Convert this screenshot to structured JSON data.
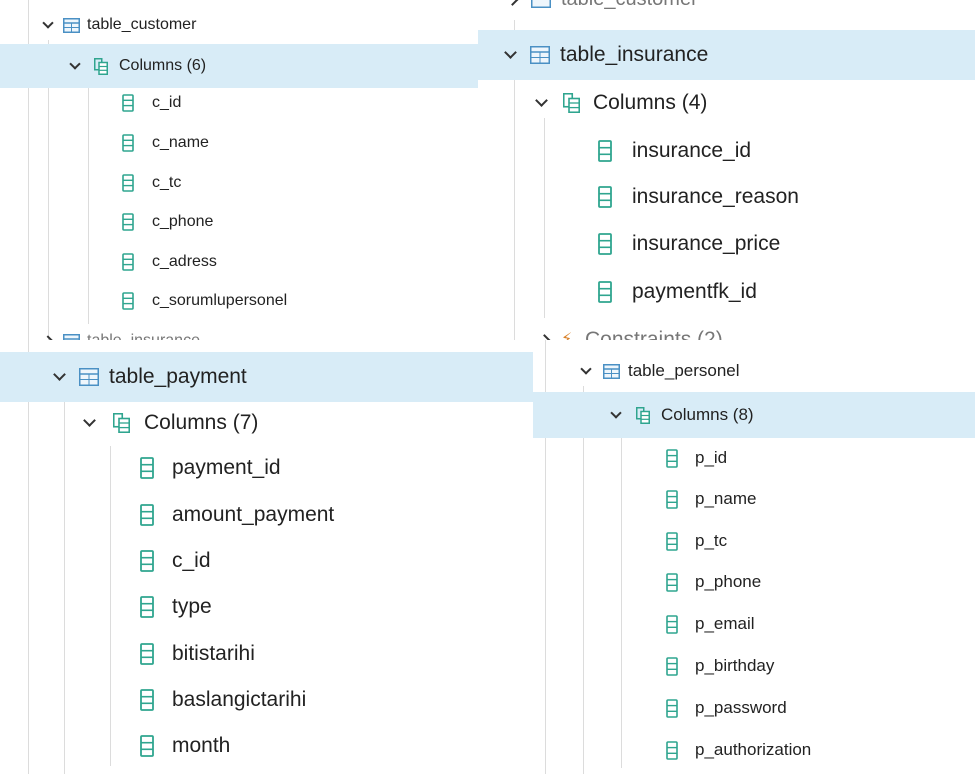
{
  "colors": {
    "highlight": "#d8ecf7",
    "table_icon": "#4a90c4",
    "column_icon": "#2fa58f",
    "constraint_icon": "#d9822b"
  },
  "customer_panel": {
    "table": {
      "label": "table_customer",
      "icon": "table-icon"
    },
    "group": {
      "label": "Columns (6)",
      "icon": "columns-icon"
    },
    "columns": [
      "c_id",
      "c_name",
      "c_tc",
      "c_phone",
      "c_adress",
      "c_sorumlupersonel"
    ],
    "next_item_partial": "table_insurance"
  },
  "insurance_panel": {
    "prev_item_partial": "table_customer",
    "table": {
      "label": "table_insurance",
      "icon": "table-icon"
    },
    "group": {
      "label": "Columns (4)",
      "icon": "columns-icon"
    },
    "columns": [
      "insurance_id",
      "insurance_reason",
      "insurance_price",
      "paymentfk_id"
    ],
    "next_item_partial": "Constraints (2)"
  },
  "payment_panel": {
    "table": {
      "label": "table_payment",
      "icon": "table-icon"
    },
    "group": {
      "label": "Columns (7)",
      "icon": "columns-icon"
    },
    "columns": [
      "payment_id",
      "amount_payment",
      "c_id",
      "type",
      "bitistarihi",
      "baslangictarihi",
      "month"
    ]
  },
  "personel_panel": {
    "table": {
      "label": "table_personel",
      "icon": "table-icon"
    },
    "group": {
      "label": "Columns (8)",
      "icon": "columns-icon"
    },
    "columns": [
      "p_id",
      "p_name",
      "p_tc",
      "p_phone",
      "p_email",
      "p_birthday",
      "p_password",
      "p_authorization"
    ]
  }
}
